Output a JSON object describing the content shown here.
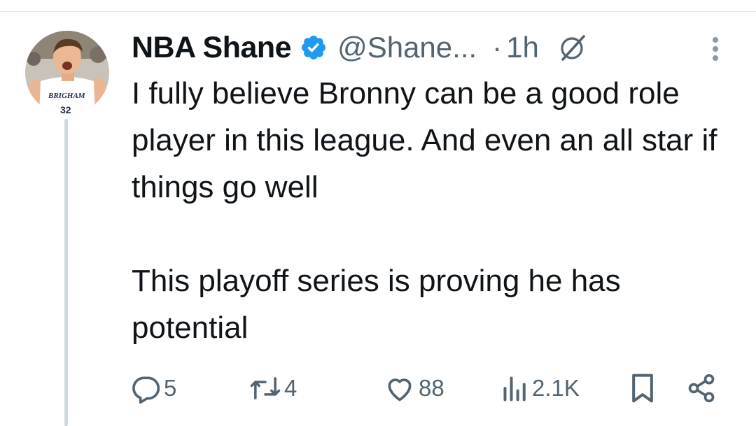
{
  "tweet": {
    "author_name": "NBA Shane",
    "handle": "@Shane...",
    "separator": "·",
    "time": "1h",
    "text": "I fully believe Bronny can be a good role player in this league. And even an all star if things go well\n\nThis playoff series is proving he has potential"
  },
  "avatar": {
    "jersey_text": "BRIGHAM",
    "jersey_number": "32"
  },
  "actions": {
    "replies": "5",
    "reposts": "4",
    "likes": "88",
    "views": "2.1K"
  },
  "colors": {
    "text": "#0f1419",
    "secondary": "#536471",
    "verified": "#1d9bf0",
    "thread_line": "#cfd9de"
  },
  "icons": {
    "verified": "verified-badge-icon",
    "grok": "grok-icon",
    "more": "more-vertical-icon",
    "reply": "reply-icon",
    "repost": "repost-icon",
    "like": "heart-icon",
    "views": "views-icon",
    "bookmark": "bookmark-icon",
    "share": "share-icon"
  }
}
